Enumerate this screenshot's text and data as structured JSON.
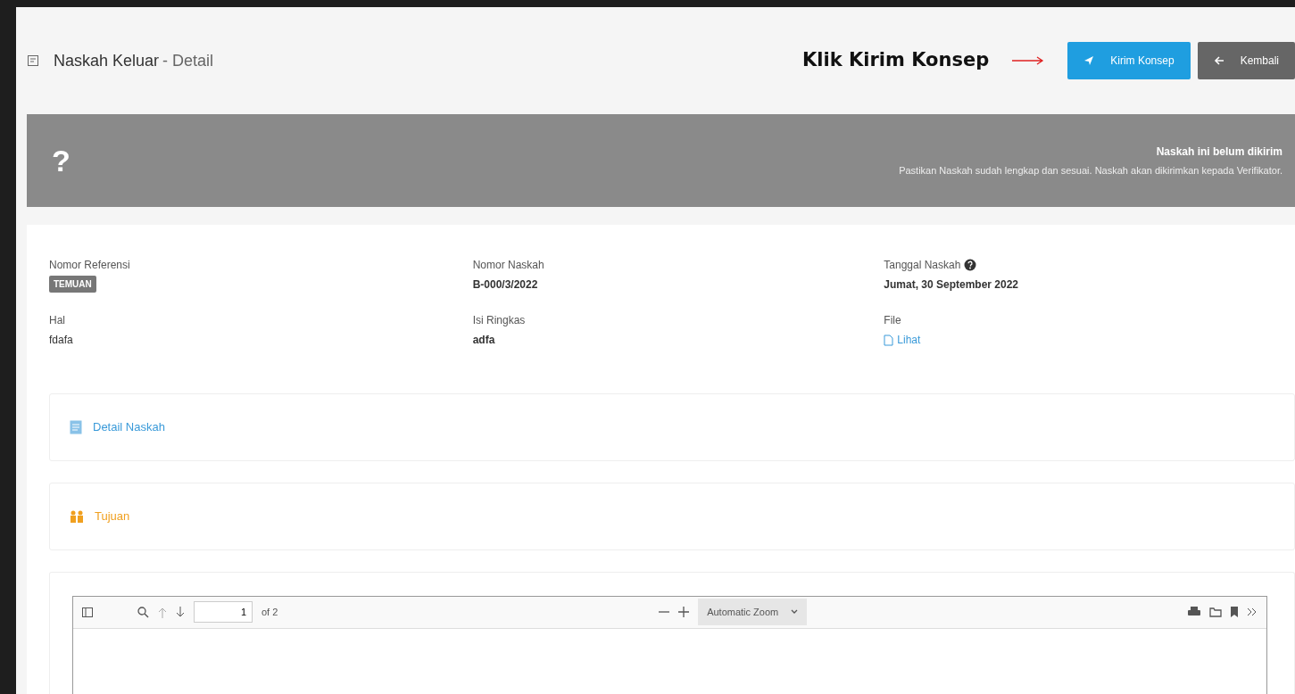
{
  "header": {
    "title": "Naskah Keluar",
    "subtitle": "- Detail"
  },
  "annotation": {
    "text": "Klik Kirim Konsep"
  },
  "buttons": [
    {
      "label": "Kirim Konsep",
      "kind": "primary"
    },
    {
      "label": "Kembali",
      "kind": "secondary"
    }
  ],
  "banner": {
    "icon": "?",
    "title": "Naskah ini belum dikirim",
    "message": "Pastikan Naskah sudah lengkap dan sesuai. Naskah akan dikirimkan kepada Verifikator."
  },
  "fields": [
    {
      "label": "Nomor Referensi",
      "value": "TEMUAN",
      "kind": "badge"
    },
    {
      "label": "Nomor Naskah",
      "value": "B-000/3/2022",
      "kind": "bold"
    },
    {
      "label": "Tanggal Naskah",
      "value": "Jumat, 30 September 2022",
      "kind": "bold",
      "help": true
    },
    {
      "label": "Hal",
      "value": "fdafa",
      "kind": "plain"
    },
    {
      "label": "Isi Ringkas",
      "value": "adfa",
      "kind": "bold"
    },
    {
      "label": "File",
      "value": "Lihat",
      "kind": "link"
    }
  ],
  "sections": [
    {
      "label": "Detail Naskah",
      "color": "#3a9ad9",
      "kind": "doc"
    },
    {
      "label": "Tujuan",
      "color": "#f0a020",
      "kind": "people"
    }
  ],
  "pdf_viewer": {
    "page": "1",
    "page_count": "of 2",
    "zoom": "Automatic Zoom"
  }
}
